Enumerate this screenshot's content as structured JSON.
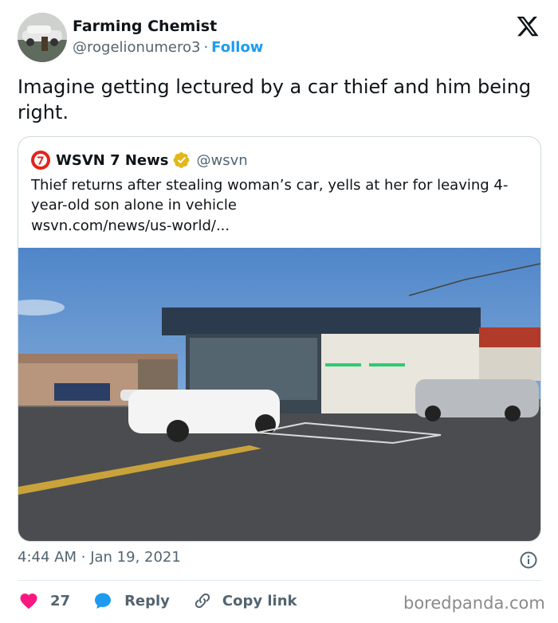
{
  "author": {
    "name": "Farming Chemist",
    "handle": "@rogelionumero3",
    "separator": "·",
    "follow_label": "Follow"
  },
  "tweet": {
    "text": "Imagine getting lectured by a car thief and him being right."
  },
  "quote": {
    "name": "WSVN 7 News",
    "handle": "@wsvn",
    "text": "Thief returns after stealing woman’s car, yells at her for leaving 4-year-old son alone in vehicle",
    "link": "wsvn.com/news/us-world/...",
    "image_icon": "news-photo-parking-lot"
  },
  "meta": {
    "time": "4:44 AM",
    "separator": "·",
    "date": "Jan 19, 2021"
  },
  "actions": {
    "like_count": "27",
    "reply_label": "Reply",
    "copy_link_label": "Copy link"
  },
  "watermark": "boredpanda.com",
  "colors": {
    "accent": "#1d9bf0",
    "like": "#f91880",
    "muted": "#536471",
    "verified": "#e2b719"
  }
}
